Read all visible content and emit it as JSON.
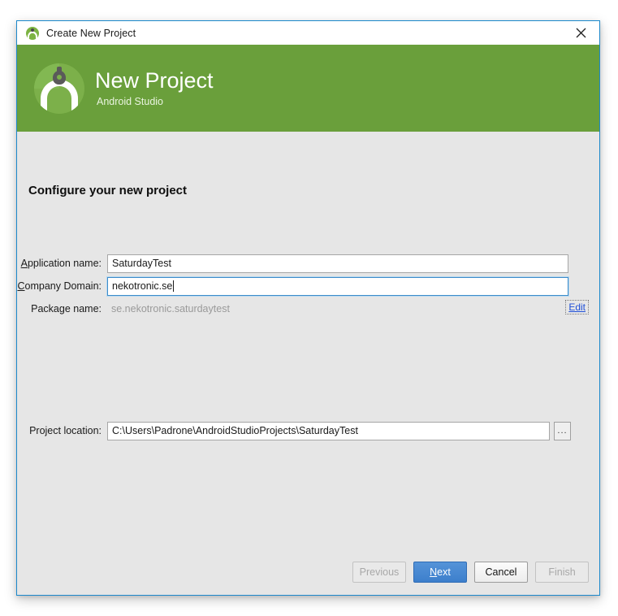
{
  "window": {
    "title": "Create New Project",
    "title_icon": "android-studio-icon",
    "close_icon": "close-icon"
  },
  "banner": {
    "title": "New Project",
    "subtitle": "Android Studio",
    "logo_icon": "android-studio-compass-logo",
    "background_color": "#6a9f3b"
  },
  "content": {
    "heading": "Configure your new project",
    "fields": {
      "application_name": {
        "label_prefix": "",
        "label_mnemonic": "A",
        "label_suffix": "pplication name:",
        "value": "SaturdayTest",
        "focused": false
      },
      "company_domain": {
        "label_prefix": "",
        "label_mnemonic": "C",
        "label_suffix": "ompany Domain:",
        "value": "nekotronic.se",
        "focused": true
      },
      "package_name": {
        "label": "Package name:",
        "value": "se.nekotronic.saturdaytest",
        "edit_link": "Edit"
      },
      "project_location": {
        "label": "Project location:",
        "value": "C:\\Users\\Padrone\\AndroidStudioProjects\\SaturdayTest",
        "browse_label": "...",
        "browse_icon": "ellipsis-icon"
      }
    }
  },
  "buttons": [
    {
      "name": "previous",
      "label": "Previous",
      "state": "disabled"
    },
    {
      "name": "next",
      "label_mnemonic": "N",
      "label_suffix": "ext",
      "state": "default"
    },
    {
      "name": "cancel",
      "label": "Cancel",
      "state": "normal"
    },
    {
      "name": "finish",
      "label": "Finish",
      "state": "disabled"
    }
  ],
  "colors": {
    "accent_green": "#6a9f3b",
    "accent_blue": "#3d7fcc",
    "window_border": "#1b88cb",
    "link_blue": "#1f4fd8",
    "dialog_background": "#e6e6e6"
  }
}
